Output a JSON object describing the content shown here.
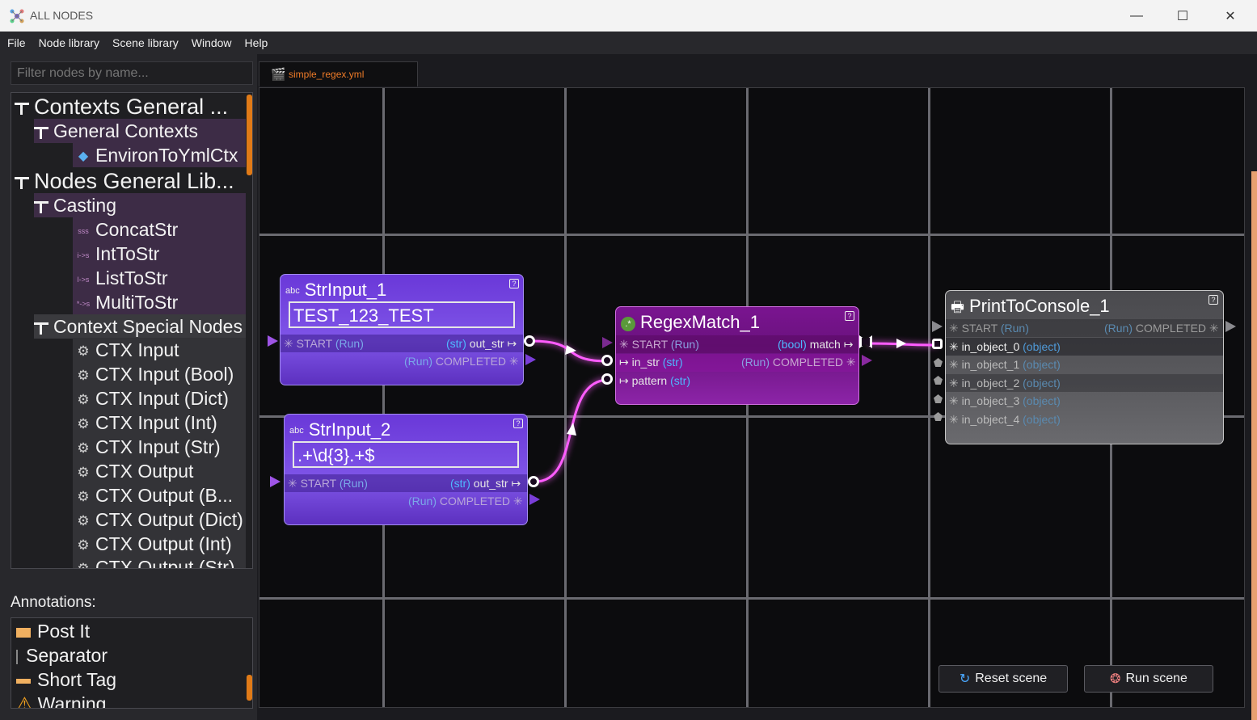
{
  "window": {
    "title": "ALL NODES",
    "minimize": "—",
    "maximize": "☐",
    "close": "✕"
  },
  "menu": [
    "File",
    "Node library",
    "Scene library",
    "Window",
    "Help"
  ],
  "filter": {
    "placeholder": "Filter nodes by name..."
  },
  "tree": {
    "contexts_group": "Contexts General ...",
    "general_contexts": "General Contexts",
    "environ_ctx": "EnvironToYmlCtx",
    "nodes_group": "Nodes General Lib...",
    "casting": "Casting",
    "casting_items": [
      {
        "label": "ConcatStr",
        "icon": "sss"
      },
      {
        "label": "IntToStr",
        "icon": "i->s"
      },
      {
        "label": "ListToStr",
        "icon": "l->s"
      },
      {
        "label": "MultiToStr",
        "icon": "*->s"
      }
    ],
    "special": "Context Special Nodes",
    "special_items": [
      "CTX Input",
      "CTX Input (Bool)",
      "CTX Input (Dict)",
      "CTX Input (Int)",
      "CTX Input (Str)",
      "CTX Output",
      "CTX Output (B...",
      "CTX Output (Dict)",
      "CTX Output (Int)",
      "CTX Output (Str)"
    ]
  },
  "annotations": {
    "label": "Annotations:",
    "items": [
      {
        "label": "Post It",
        "icon": "post-it-icon"
      },
      {
        "label": "Separator",
        "icon": "separator-icon"
      },
      {
        "label": "Short Tag",
        "icon": "tag-icon"
      },
      {
        "label": "Warning",
        "icon": "warning-icon"
      }
    ]
  },
  "tab": {
    "label": "simple_regex.yml"
  },
  "nodes": {
    "str1": {
      "title": "StrInput_1",
      "badge": "abc",
      "value": "TEST_123_TEST",
      "start": "START",
      "run": "(Run)",
      "out_type": "(str)",
      "out": "out_str",
      "completed": "COMPLETED"
    },
    "str2": {
      "title": "StrInput_2",
      "badge": "abc",
      "value": ".+\\d{3}.+$",
      "start": "START",
      "run": "(Run)",
      "out_type": "(str)",
      "out": "out_str",
      "completed": "COMPLETED"
    },
    "regex": {
      "title": "RegexMatch_1",
      "start": "START",
      "run": "(Run)",
      "match_type": "(bool)",
      "match": "match",
      "in_str": "in_str",
      "in_str_type": "(str)",
      "completed": "COMPLETED",
      "pattern": "pattern",
      "pattern_type": "(str)"
    },
    "print": {
      "title": "PrintToConsole_1",
      "start": "START",
      "run": "(Run)",
      "completed": "COMPLETED",
      "inputs": [
        "in_object_0",
        "in_object_1",
        "in_object_2",
        "in_object_3",
        "in_object_4"
      ],
      "input_type": "(object)"
    }
  },
  "buttons": {
    "reset": "Reset scene",
    "run": "Run scene"
  },
  "colors": {
    "accent": "#e07a17",
    "node_purple": "#7a4ee0",
    "node_magenta": "#8a1a9a",
    "wire": "#ff4dff"
  }
}
